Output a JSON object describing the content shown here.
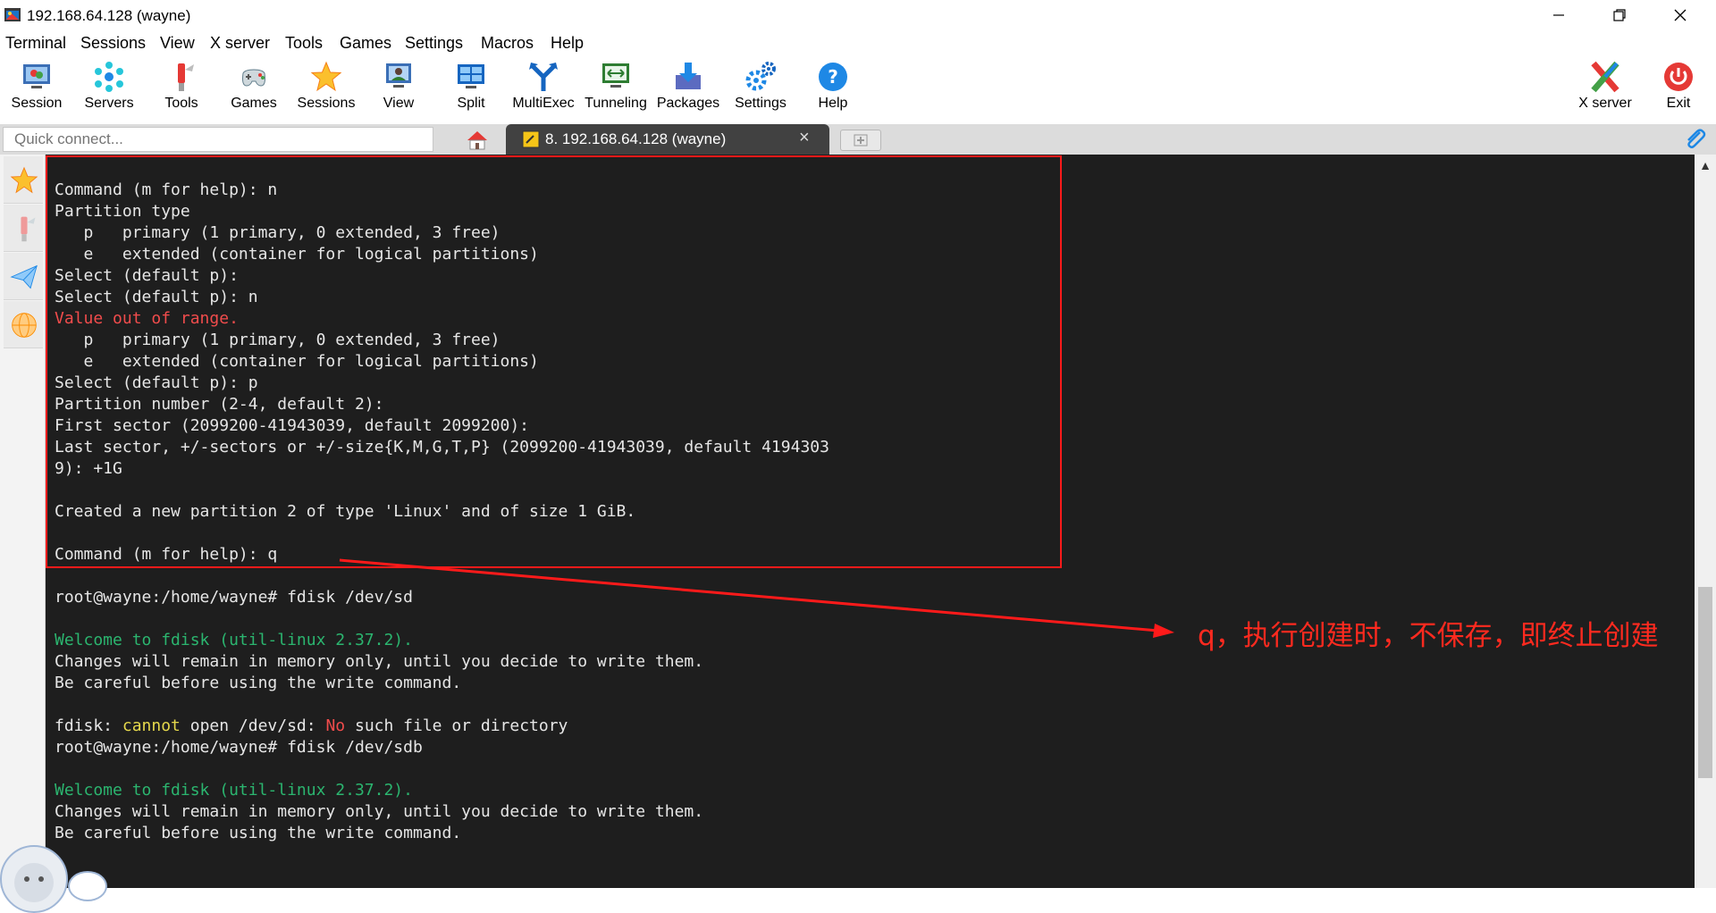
{
  "window": {
    "title": "192.168.64.128 (wayne)",
    "controls": [
      "minimize-icon",
      "restore-icon",
      "close-icon"
    ]
  },
  "menu": [
    "Terminal",
    "Sessions",
    "View",
    "X server",
    "Tools",
    "Games",
    "Settings",
    "Macros",
    "Help"
  ],
  "toolbar": {
    "items": [
      {
        "label": "Session",
        "icon": "session-icon"
      },
      {
        "label": "Servers",
        "icon": "servers-icon"
      },
      {
        "label": "Tools",
        "icon": "tools-icon"
      },
      {
        "label": "Games",
        "icon": "gamepad-icon"
      },
      {
        "label": "Sessions",
        "icon": "star-icon"
      },
      {
        "label": "View",
        "icon": "view-icon"
      },
      {
        "label": "Split",
        "icon": "split-icon"
      },
      {
        "label": "MultiExec",
        "icon": "multiexec-icon"
      },
      {
        "label": "Tunneling",
        "icon": "tunneling-icon"
      },
      {
        "label": "Packages",
        "icon": "packages-icon"
      },
      {
        "label": "Settings",
        "icon": "gears-icon"
      },
      {
        "label": "Help",
        "icon": "help-icon"
      }
    ],
    "right_items": [
      {
        "label": "X server",
        "icon": "x-server-icon"
      },
      {
        "label": "Exit",
        "icon": "power-icon"
      }
    ]
  },
  "quick_connect": {
    "placeholder": "Quick connect..."
  },
  "tabs": {
    "home_icon": "home-icon",
    "session_tab": "8. 192.168.64.128 (wayne)",
    "session_tab_close": "×"
  },
  "side_panel": [
    "star-icon",
    "tools-icon",
    "paper-plane-icon",
    "globe-icon"
  ],
  "terminal": {
    "lines": [
      [
        {
          "t": "Command (m for help): n"
        }
      ],
      [
        {
          "t": "Partition type"
        }
      ],
      [
        {
          "t": "   p   primary (1 primary, 0 extended, 3 free)"
        }
      ],
      [
        {
          "t": "   e   extended (container for logical partitions)"
        }
      ],
      [
        {
          "t": "Select (default p):"
        }
      ],
      [
        {
          "t": "Select (default p): n"
        }
      ],
      [
        {
          "t": "Value out of range.",
          "c": "red"
        }
      ],
      [
        {
          "t": "   p   primary (1 primary, 0 extended, 3 free)"
        }
      ],
      [
        {
          "t": "   e   extended (container for logical partitions)"
        }
      ],
      [
        {
          "t": "Select (default p): p"
        }
      ],
      [
        {
          "t": "Partition number (2-4, default 2):"
        }
      ],
      [
        {
          "t": "First sector (2099200-41943039, default 2099200):"
        }
      ],
      [
        {
          "t": "Last sector, +/-sectors or +/-size{K,M,G,T,P} (2099200-41943039, default 4194303"
        }
      ],
      [
        {
          "t": "9): +1G"
        }
      ],
      [
        {
          "t": ""
        }
      ],
      [
        {
          "t": "Created a new partition 2 of type 'Linux' and of size 1 GiB."
        }
      ],
      [
        {
          "t": ""
        }
      ],
      [
        {
          "t": "Command (m for help): q"
        }
      ],
      [
        {
          "t": ""
        }
      ],
      [
        {
          "t": "root@wayne:/home/wayne# fdisk /dev/sd"
        }
      ],
      [
        {
          "t": ""
        }
      ],
      [
        {
          "t": "Welcome to fdisk (util-linux 2.37.2).",
          "c": "green"
        }
      ],
      [
        {
          "t": "Changes will remain in memory only, until you decide to write them."
        }
      ],
      [
        {
          "t": "Be careful before using the write command."
        }
      ],
      [
        {
          "t": ""
        }
      ],
      [
        {
          "t": "fdisk: "
        },
        {
          "t": "cannot",
          "c": "yellow"
        },
        {
          "t": " open /dev/sd: "
        },
        {
          "t": "No",
          "c": "red"
        },
        {
          "t": " such file or directory"
        }
      ],
      [
        {
          "t": "root@wayne:/home/wayne# fdisk /dev/sdb"
        }
      ],
      [
        {
          "t": ""
        }
      ],
      [
        {
          "t": "Welcome to fdisk (util-linux 2.37.2).",
          "c": "green"
        }
      ],
      [
        {
          "t": "Changes will remain in memory only, until you decide to write them."
        }
      ],
      [
        {
          "t": "Be careful before using the write command."
        }
      ]
    ]
  },
  "annotation": {
    "text": "q，执行创建时，不保存，即终止创建",
    "color": "#ff2a1f"
  },
  "colors": {
    "terminal_bg": "#1e1e1e",
    "terminal_fg": "#e6e6e6",
    "error_red": "#f14c4c",
    "success_green": "#2bb56f",
    "warn_yellow": "#e5d84c",
    "active_tab": "#414141",
    "annotation_red": "#ff1a1a"
  }
}
